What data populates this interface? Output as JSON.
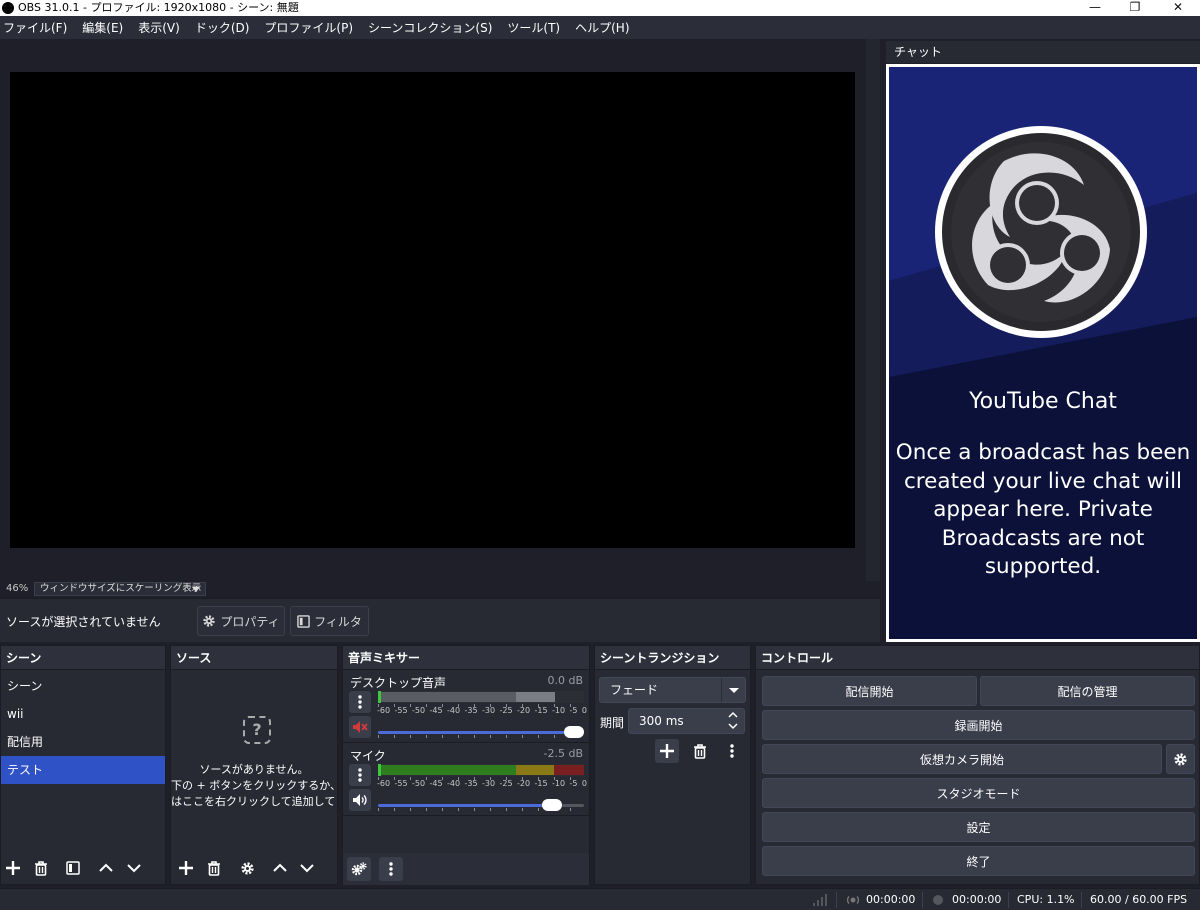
{
  "window": {
    "title": "OBS 31.0.1 - プロファイル: 1920x1080 - シーン: 無題",
    "controls": {
      "minimize": "—",
      "restore": "❐",
      "close": "✕"
    }
  },
  "menu": [
    "ファイル(F)",
    "編集(E)",
    "表示(V)",
    "ドック(D)",
    "プロファイル(P)",
    "シーンコレクション(S)",
    "ツール(T)",
    "ヘルプ(H)"
  ],
  "preview": {
    "zoom": "46%",
    "scaling_mode": "ウィンドウサイズにスケーリング表示"
  },
  "context": {
    "no_source": "ソースが選択されていません",
    "properties_label": "プロパティ",
    "filters_label": "フィルタ"
  },
  "chat": {
    "dock_title": "チャット",
    "heading": "YouTube Chat",
    "message": "Once a broadcast has been created your live chat will appear here. Private Broadcasts are not supported."
  },
  "scenes": {
    "title": "シーン",
    "items": [
      "シーン",
      "wii",
      "配信用",
      "テスト"
    ],
    "selected_index": 3
  },
  "sources": {
    "title": "ソース",
    "empty_line1": "ソースがありません。",
    "empty_line2": "下の + ボタンをクリックするか、",
    "empty_line3": "はここを右クリックして追加してくださ"
  },
  "mixer": {
    "title": "音声ミキサー",
    "ticks": [
      "-60",
      "-55",
      "-50",
      "-45",
      "-40",
      "-35",
      "-30",
      "-25",
      "-20",
      "-15",
      "-10",
      "-5",
      "0"
    ],
    "channels": [
      {
        "name": "デスクトップ音声",
        "db": "0.0 dB",
        "muted": true,
        "volume": 1.0
      },
      {
        "name": "マイク",
        "db": "-2.5 dB",
        "muted": false,
        "volume": 0.87
      }
    ]
  },
  "transitions": {
    "title": "シーントランジション",
    "selected": "フェード",
    "duration_label": "期間",
    "duration_value": "300 ms"
  },
  "controls": {
    "title": "コントロール",
    "start_streaming": "配信開始",
    "manage_broadcast": "配信の管理",
    "start_recording": "録画開始",
    "start_virtual_camera": "仮想カメラ開始",
    "studio_mode": "スタジオモード",
    "settings": "設定",
    "exit": "終了"
  },
  "status": {
    "stream_time": "00:00:00",
    "record_time": "00:00:00",
    "cpu": "CPU: 1.1%",
    "fps": "60.00 / 60.00 FPS"
  },
  "colors": {
    "accent": "#2f52c7",
    "bg": "#1e1f29",
    "dock": "#272a33",
    "meter_green": "#2e7d1f",
    "meter_yellow": "#8a7a16",
    "meter_red": "#7a1f1f",
    "slider": "#4a6bd8",
    "chat_bg": "#0b1138"
  }
}
